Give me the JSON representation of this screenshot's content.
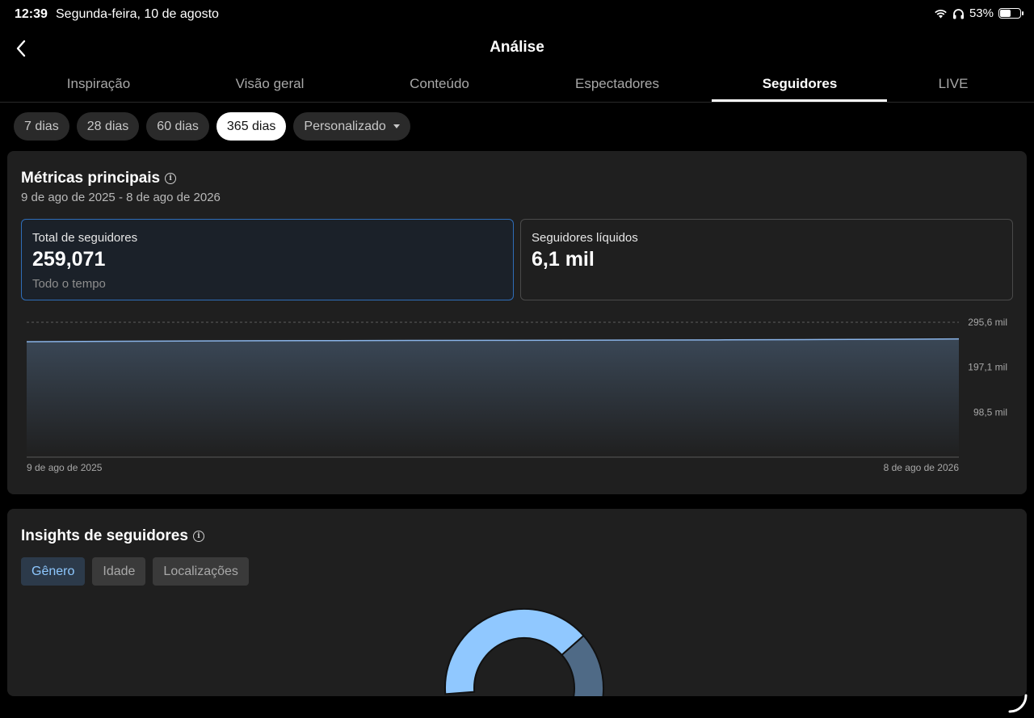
{
  "status_bar": {
    "time": "12:39",
    "date": "Segunda-feira, 10 de agosto",
    "battery_percent": "53%",
    "battery_level": 0.53,
    "icons": [
      "wifi-icon",
      "headphones-icon",
      "battery-icon"
    ]
  },
  "header": {
    "title": "Análise",
    "back_icon": "chevron-left-icon"
  },
  "tabs": [
    {
      "label": "Inspiração",
      "active": false
    },
    {
      "label": "Visão geral",
      "active": false
    },
    {
      "label": "Conteúdo",
      "active": false
    },
    {
      "label": "Espectadores",
      "active": false
    },
    {
      "label": "Seguidores",
      "active": true
    },
    {
      "label": "LIVE",
      "active": false
    }
  ],
  "range_chips": [
    {
      "label": "7 dias",
      "active": false
    },
    {
      "label": "28 dias",
      "active": false
    },
    {
      "label": "60 dias",
      "active": false
    },
    {
      "label": "365 dias",
      "active": true
    },
    {
      "label": "Personalizado",
      "active": false,
      "dropdown": true
    }
  ],
  "main_metrics": {
    "title": "Métricas principais",
    "date_range": "9 de ago de 2025 - 8 de ago de 2026",
    "cards": [
      {
        "label": "Total de seguidores",
        "value": "259,071",
        "footnote": "Todo o tempo",
        "selected": true
      },
      {
        "label": "Seguidores líquidos",
        "value": "6,1 mil",
        "footnote": "",
        "selected": false
      }
    ]
  },
  "chart_data": {
    "type": "area",
    "title": "",
    "xlabel": "",
    "ylabel": "",
    "x_tick_labels": [
      "9 de ago de 2025",
      "8 de ago de 2026"
    ],
    "y_tick_labels": [
      "295,6 mil",
      "197,1 mil",
      "98,5 mil"
    ],
    "y_ticks": [
      295600,
      197100,
      98500
    ],
    "ylim": [
      0,
      295600
    ],
    "grid": true,
    "series": [
      {
        "values": [
          253000,
          253800,
          254500,
          255000,
          255400,
          255700,
          256000,
          256300,
          256700,
          257100,
          257600,
          258300,
          259071
        ]
      }
    ],
    "colors": {
      "line": "#8ab4e8",
      "fill_top": "#3a4756",
      "fill_bottom": "#1f1f1f"
    }
  },
  "insights": {
    "title": "Insights de seguidores",
    "tabs": [
      {
        "label": "Gênero",
        "active": true
      },
      {
        "label": "Idade",
        "active": false
      },
      {
        "label": "Localizações",
        "active": false
      }
    ],
    "gender_donut": {
      "segments": [
        {
          "share": 0.69,
          "color": "#90c8ff"
        },
        {
          "share": 0.31,
          "color": "#4f6a86"
        }
      ]
    }
  }
}
